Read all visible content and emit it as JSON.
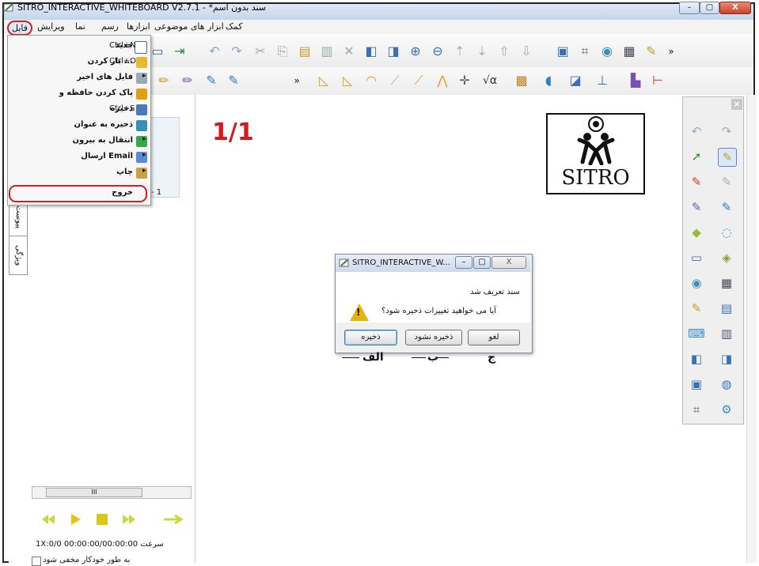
{
  "window": {
    "title": "SITRO_INTERACTIVE_WHITEBOARD V2.7.1 - *سند بدون اسم",
    "min_glyph": "–",
    "max_glyph": "▢",
    "close_glyph": "X"
  },
  "menubar": {
    "items": [
      "فایل",
      "ویرایش",
      "نما",
      "رسم",
      "ابزارها",
      "ابزار های موضوعی",
      "کمک"
    ]
  },
  "file_menu": {
    "items": [
      {
        "label": "جدید",
        "shortcut": "Ctrl+N",
        "submenu": false
      },
      {
        "label": "باز کردن ...",
        "shortcut": "Ctrl+O",
        "submenu": false
      },
      {
        "label": "فایل های اخیر",
        "shortcut": "",
        "submenu": true
      },
      {
        "label": "پاک کردن حافظه و",
        "shortcut": "",
        "submenu": false
      },
      {
        "label": "ذخیره",
        "shortcut": "Ctrl+S",
        "submenu": false
      },
      {
        "label": "ذخیره به عنوان",
        "shortcut": "",
        "submenu": false
      },
      {
        "label": "انتقال به بیرون",
        "shortcut": "",
        "submenu": true
      },
      {
        "label": "ارسال Email",
        "shortcut": "",
        "submenu": true
      },
      {
        "label": "چاپ",
        "shortcut": "",
        "submenu": true
      },
      {
        "label": "خروج",
        "shortcut": "",
        "submenu": false
      }
    ],
    "arrow_glyph": "▸",
    "stub_text": "- 1"
  },
  "side_tabs": [
    "پیوست",
    "ویژگی"
  ],
  "canvas": {
    "page_indicator": "1/1",
    "logo_text": "SITRO"
  },
  "left_panel": {
    "status": "1X:سرعت    00:00:00/00:00:00   0/0",
    "auto_hide": "به طور خودکار مخفی شود",
    "scroll_mark": "III"
  },
  "palette": {
    "close_glyph": "×"
  },
  "dialog": {
    "title": "SITRO_INTERACTIVE_W...",
    "message_1": "سند تعریف شد",
    "message_2": "آیا می خواهید تغییرات ذخیره شود؟",
    "buttons": {
      "save": "ذخیره",
      "dont_save": "ذخیره نشود",
      "cancel": "لغو"
    },
    "labels": {
      "save": "الف",
      "dont_save": "ب",
      "cancel": "ج"
    },
    "warn_mark": "!"
  },
  "toolbar": {
    "more_glyph": "»",
    "sqrt_glyph": "√α"
  }
}
